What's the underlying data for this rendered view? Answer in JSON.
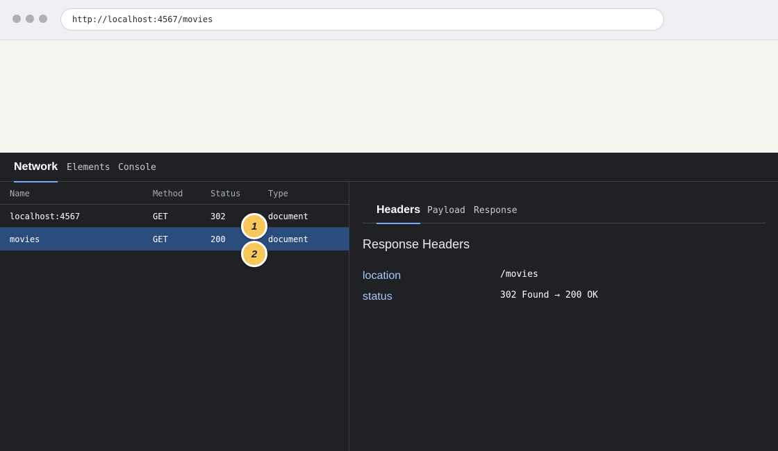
{
  "browser": {
    "window_controls": [
      "close-dot",
      "minimize-dot",
      "maximize-dot"
    ],
    "url": "http://localhost:4567/movies"
  },
  "devtools": {
    "tabs": [
      {
        "label": "Network",
        "active": true
      },
      {
        "label": "Elements",
        "active": false
      },
      {
        "label": "Console",
        "active": false
      }
    ],
    "network": {
      "columns": [
        "Name",
        "Method",
        "Status",
        "Type"
      ],
      "rows": [
        {
          "name": "localhost:4567",
          "method": "GET",
          "status": "302",
          "type": "document",
          "selected": false
        },
        {
          "name": "movies",
          "method": "GET",
          "status": "200",
          "type": "document",
          "selected": true
        }
      ],
      "annotations": [
        "1",
        "2"
      ]
    },
    "detail": {
      "tabs": [
        {
          "label": "Headers",
          "active": true
        },
        {
          "label": "Payload",
          "active": false
        },
        {
          "label": "Response",
          "active": false
        }
      ],
      "section_title": "Response Headers",
      "headers": [
        {
          "key": "location",
          "value": "/movies"
        },
        {
          "key": "status",
          "value": "302 Found → 200 OK"
        }
      ]
    }
  },
  "colors": {
    "selected_row": "#2b4d7e",
    "accent": "#7aa7ff",
    "badge": "#f5c75c",
    "devtools_bg": "#202124",
    "header_key": "#a8c7fa"
  }
}
